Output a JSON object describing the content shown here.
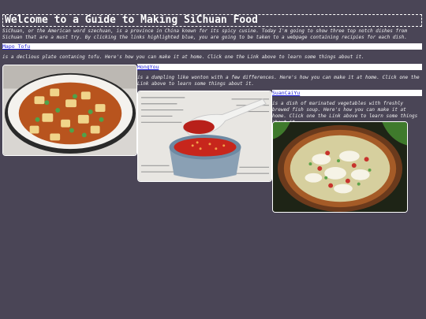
{
  "page": {
    "title": "Welcome to a Guide to Making SiChuan Food",
    "intro": "SiChuan, or the American word szechuan, is a province in China known for its spicy cusine. Today I'm going to show three top notch dishes from Sichuan that are a must try. By clicking the links highlighted blue, you are going to be taken to a webpage containing recipies for each dish."
  },
  "dishes": [
    {
      "link": "Mapo Tofu",
      "description": "is a declious plate contaning tofu. Here's how you can make it at home. Click one the Link above to learn some things about it.",
      "image_icon": "mapo-tofu-photo"
    },
    {
      "link": "HongYou",
      "description": "is a dumpling like wonton with a few differences. Here's how you can make it at home. Click one the Link above to learn some things about it.",
      "image_icon": "chili-oil-photo"
    },
    {
      "link": "SuanCaiYu",
      "description": "is a dish of marinated vegetables with freshly brewed fish soup. Here's how you can make it at home. Click one the Link above to learn some things about it.",
      "image_icon": "fish-soup-photo"
    }
  ],
  "colors": {
    "background": "#4a4556",
    "link": "#1a1ad8",
    "linkbar": "#ffffff"
  }
}
